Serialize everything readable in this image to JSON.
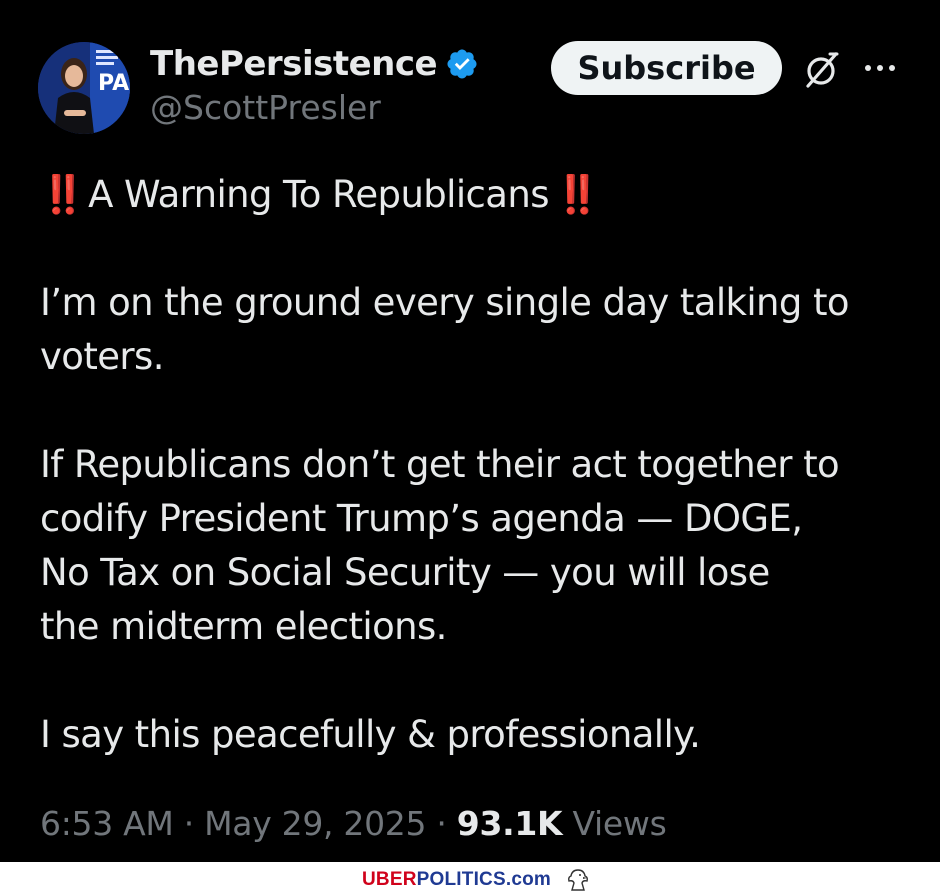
{
  "header": {
    "display_name": "ThePersistence",
    "handle": "@ScottPresler",
    "subscribe_label": "Subscribe",
    "icons": {
      "verified": "verified-badge-icon",
      "grok": "grok-icon",
      "more": "more-options-icon"
    }
  },
  "tweet": {
    "warning_line": "A Warning To Republicans",
    "emoji": "‼️",
    "para1_line1": "I’m on the ground every single day talking to",
    "para1_line2": "voters.",
    "para2_line1": "If Republicans don’t get their act together to",
    "para2_line2": "codify President Trump’s agenda — DOGE,",
    "para2_line3": "No Tax on Social Security — you will lose",
    "para2_line4": "the midterm elections.",
    "para3_line1": "I say this peacefully & professionally."
  },
  "meta": {
    "time": "6:53 AM",
    "separator": " · ",
    "date": "May 29, 2025",
    "views_count": "93.1K",
    "views_label": "Views"
  },
  "watermark": {
    "brand_red": "UBER",
    "brand_blue": "POLITICS.com"
  },
  "colors": {
    "background": "#000000",
    "text": "#e7e9ea",
    "muted": "#71767b",
    "verified_blue": "#1d9bf0",
    "emoji_red": "#e0245e"
  }
}
